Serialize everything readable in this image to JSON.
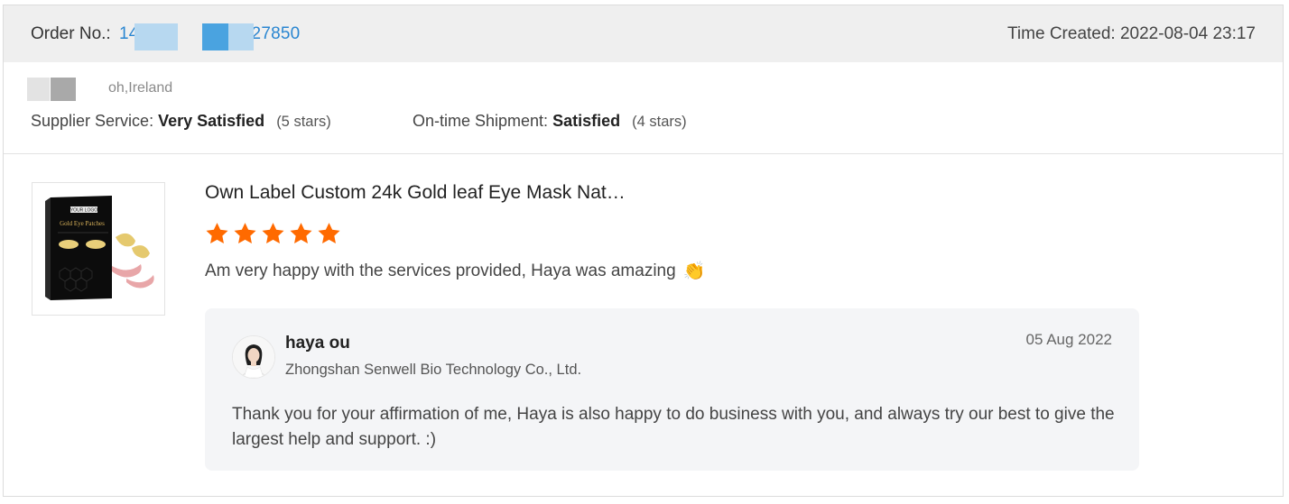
{
  "header": {
    "order_label": "Order No.:",
    "order_number_prefix": "14",
    "order_number_suffix": "27850",
    "time_created": "Time Created: 2022-08-04 23:17"
  },
  "buyer": {
    "location_text": "oh,Ireland"
  },
  "ratings": {
    "supplier_label": "Supplier Service:",
    "supplier_value": "Very Satisfied",
    "supplier_stars": "(5 stars)",
    "shipment_label": "On-time Shipment:",
    "shipment_value": "Satisfied",
    "shipment_stars": "(4 stars)"
  },
  "product": {
    "title": "Own Label Custom 24k Gold leaf Eye Mask Nat…",
    "thumbnail_logo_text": "YOUR LOGO",
    "thumbnail_box_text": "Gold Eye Patches",
    "rating": 5,
    "star_color": "#ff6a00",
    "review": "Am very happy with the services provided, Haya was amazing",
    "review_emoji": "👏"
  },
  "reply": {
    "name": "haya ou",
    "company": "Zhongshan Senwell Bio Technology Co., Ltd.",
    "date": "05 Aug 2022",
    "text": "Thank you for your affirmation of me, Haya is also happy to do business with you, and always try our best to give the largest help and support. :)"
  },
  "colors": {
    "accent_link": "#2a86d1",
    "header_bg": "#efefef",
    "reply_bg": "#f4f5f7"
  }
}
